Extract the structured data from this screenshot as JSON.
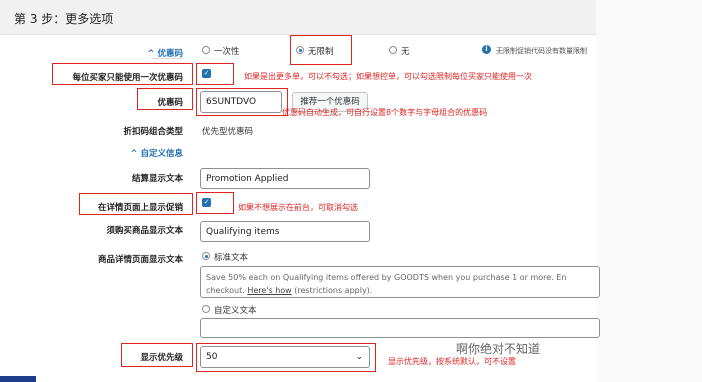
{
  "header": {
    "title": "第 3 步：更多选项"
  },
  "coupon_type": {
    "label": "优惠码",
    "collapse_arrow": "^",
    "options": [
      "一次性",
      "无限制",
      "无"
    ],
    "selected": "无限制",
    "info_text": "无限制促销代码没有数量限制"
  },
  "once_per_buyer": {
    "label": "每位买家只能使用一次优惠码",
    "checked": true,
    "annotation": "如果是出更多单，可以不勾选；如果想控单，可以勾选限制每位买家只能使用一次"
  },
  "coupon_code": {
    "label": "优惠码",
    "value": "6SUNTDVO",
    "suggest_button": "推荐一个优惠码",
    "annotation": "优惠码自动生成，可自行设置8个数字与字母组合的优惠码"
  },
  "combination": {
    "label": "折扣码组合类型",
    "value": "优先型优惠码"
  },
  "custom_info": {
    "label": "自定义信息",
    "collapse_arrow": "^"
  },
  "checkout_text": {
    "label": "结算显示文本",
    "value": "Promotion Applied"
  },
  "show_on_detail": {
    "label": "在详情页面上显示促销",
    "checked": true,
    "annotation": "如果不想展示在前台，可取消勾选"
  },
  "qualifying_text": {
    "label": "须购买商品显示文本",
    "value": "Qualifying items"
  },
  "detail_page_text": {
    "label": "商品详情页面显示文本",
    "standard_option": "标准文本",
    "custom_option": "自定义文本",
    "standard_line1": "Save 50% each on Qualifying items offered by GOODTS when you purchase 1 or more. En",
    "standard_line2_pre": "checkout. ",
    "standard_link": "Here's how",
    "standard_line2_post": " (restrictions apply)."
  },
  "priority": {
    "label": "显示优先级",
    "value": "50",
    "annotation": "显示优先级，按系统默认，可不设置"
  },
  "watermark": "啊你绝对不知道"
}
